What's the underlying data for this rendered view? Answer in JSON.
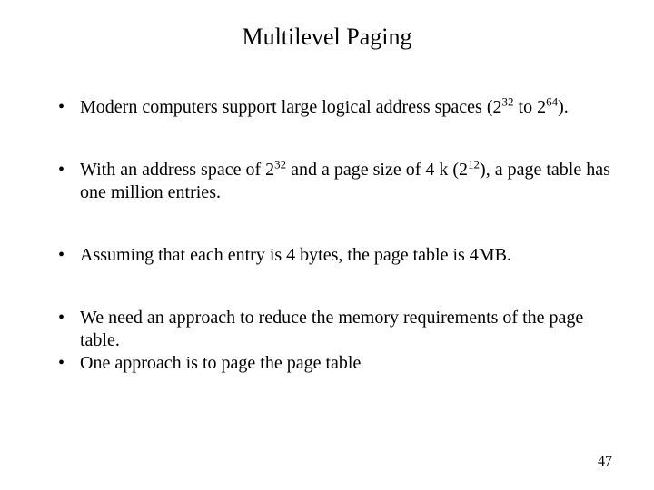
{
  "title": "Multilevel Paging",
  "bullets": [
    {
      "pre": "Modern computers support large logical address spaces (2",
      "sup1": "32",
      "mid": " to 2",
      "sup2": "64",
      "post": ")."
    },
    {
      "pre": "With an address space of 2",
      "sup1": "32",
      "mid": " and a page size of 4 k (2",
      "sup2": "12",
      "post": "), a page table has one million entries."
    },
    {
      "plain": "Assuming that each entry is 4 bytes, the page table is 4MB."
    },
    {
      "plain": "We need an approach to reduce the memory requirements of the page table."
    },
    {
      "plain": "One approach is to page the page table"
    }
  ],
  "page_number": "47"
}
